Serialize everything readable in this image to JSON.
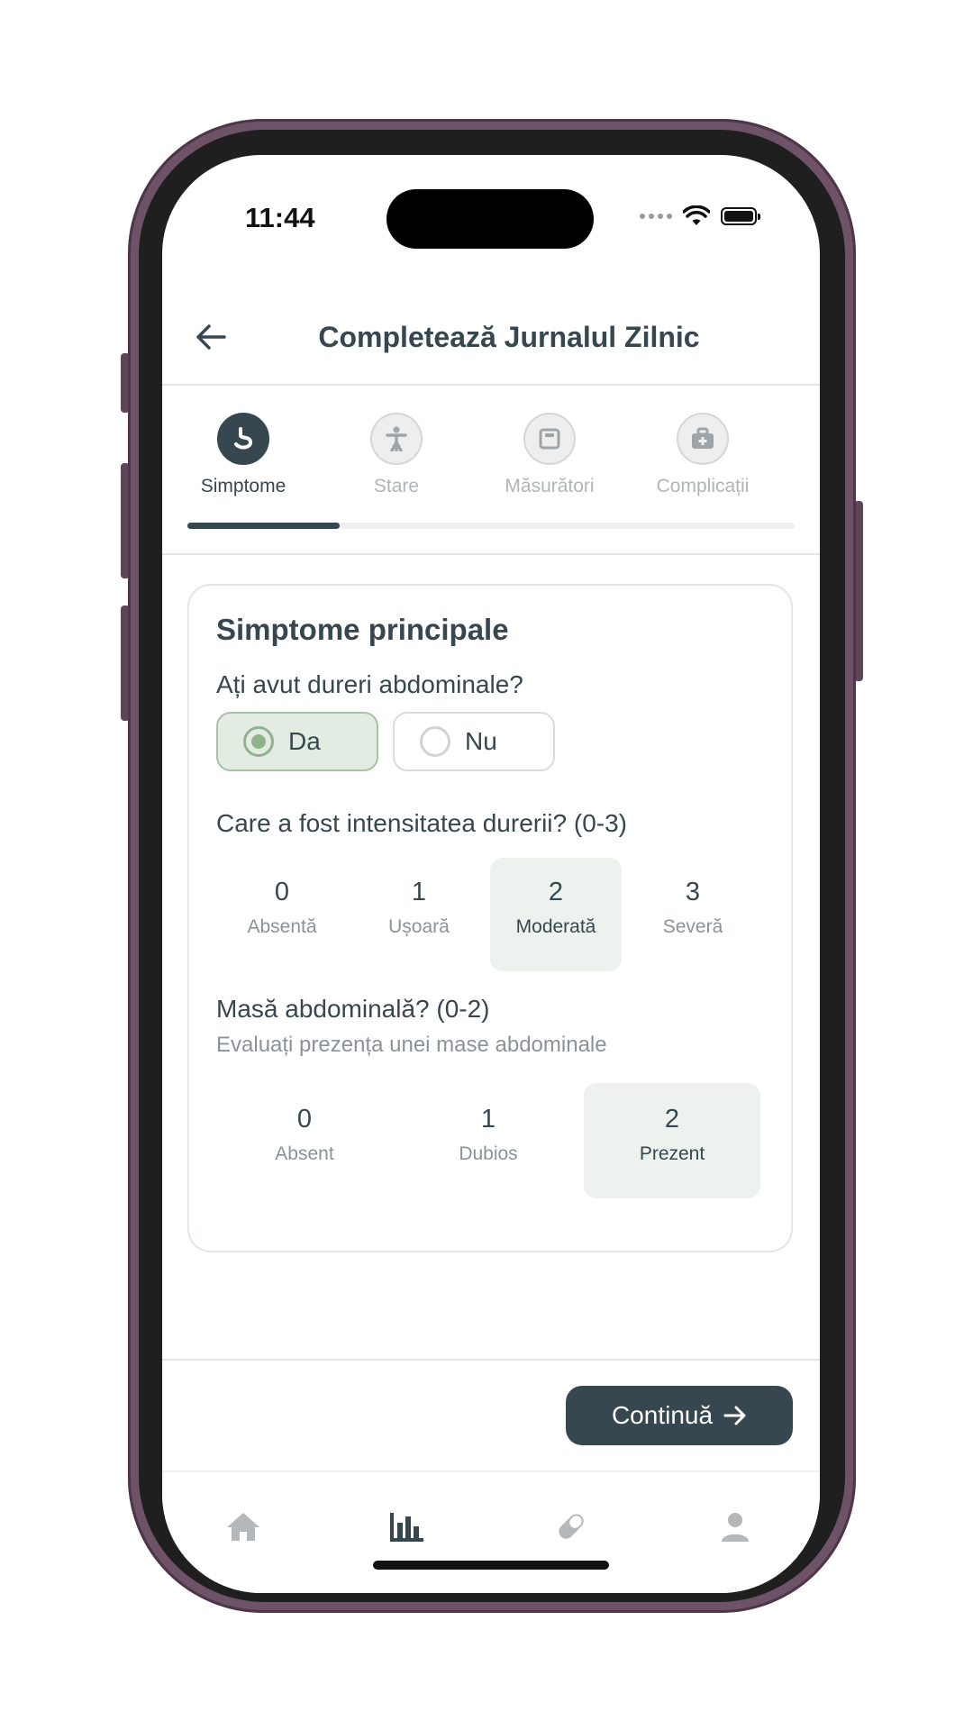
{
  "status_bar": {
    "time": "11:44"
  },
  "header": {
    "title": "Completează Jurnalul Zilnic"
  },
  "tabs": [
    {
      "label": "Simptome",
      "active": true
    },
    {
      "label": "Stare",
      "active": false
    },
    {
      "label": "Măsurători",
      "active": false
    },
    {
      "label": "Complicații",
      "active": false
    }
  ],
  "progress": {
    "fraction": 0.25
  },
  "card": {
    "title": "Simptome principale",
    "q1": {
      "question": "Ați avut dureri abdominale?",
      "options": [
        {
          "label": "Da",
          "selected": true
        },
        {
          "label": "Nu",
          "selected": false
        }
      ]
    },
    "q2": {
      "question": "Care a fost intensitatea durerii? (0-3)",
      "options": [
        {
          "value": "0",
          "label": "Absentă",
          "selected": false
        },
        {
          "value": "1",
          "label": "Ușoară",
          "selected": false
        },
        {
          "value": "2",
          "label": "Moderată",
          "selected": true
        },
        {
          "value": "3",
          "label": "Severă",
          "selected": false
        }
      ]
    },
    "q3": {
      "question": "Masă abdominală? (0-2)",
      "subtitle": "Evaluați prezența unei mase abdominale",
      "options": [
        {
          "value": "0",
          "label": "Absent",
          "selected": false
        },
        {
          "value": "1",
          "label": "Dubios",
          "selected": false
        },
        {
          "value": "2",
          "label": "Prezent",
          "selected": true
        }
      ]
    }
  },
  "continue_label": "Continuă",
  "bottom_nav": {
    "active": "stats-icon"
  },
  "colors": {
    "primary": "#37474f",
    "selected_green": "#8fb38f",
    "selected_bg": "#eef2ee"
  }
}
